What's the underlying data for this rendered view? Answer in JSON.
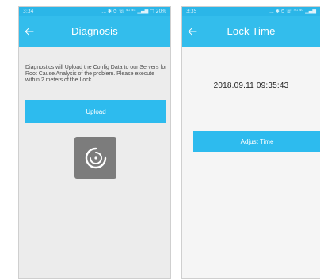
{
  "left_screen": {
    "status": {
      "time": "3:34",
      "icons": "... ✱ ⏱ ☏ ⁴ᴳ ⁴ᴳ ▂▄▆ ▢ 20%"
    },
    "header": {
      "title": "Diagnosis",
      "back_icon": "arrow-left-icon"
    },
    "description": "Diagnostics will Upload the Config Data to our Servers for Root Cause Analysis of the problem. Please execute within 2 meters of the Lock.",
    "upload_label": "Upload",
    "spinner_icon": "loading-spinner-icon"
  },
  "right_screen": {
    "status": {
      "time": "3:35",
      "icons": "... ✱ ⏱ ☏ ⁴ᴳ ⁴ᴳ ▂▄▆"
    },
    "header": {
      "title": "Lock Time",
      "back_icon": "arrow-left-icon"
    },
    "datetime": "2018.09.11 09:35:43",
    "adjust_label": "Adjust Time"
  },
  "colors": {
    "accent": "#33bdec",
    "statusbar": "#2bb6e8",
    "left_background": "#ececec",
    "right_background": "#f5f5f5",
    "spinner_background": "#7c7c7c"
  }
}
